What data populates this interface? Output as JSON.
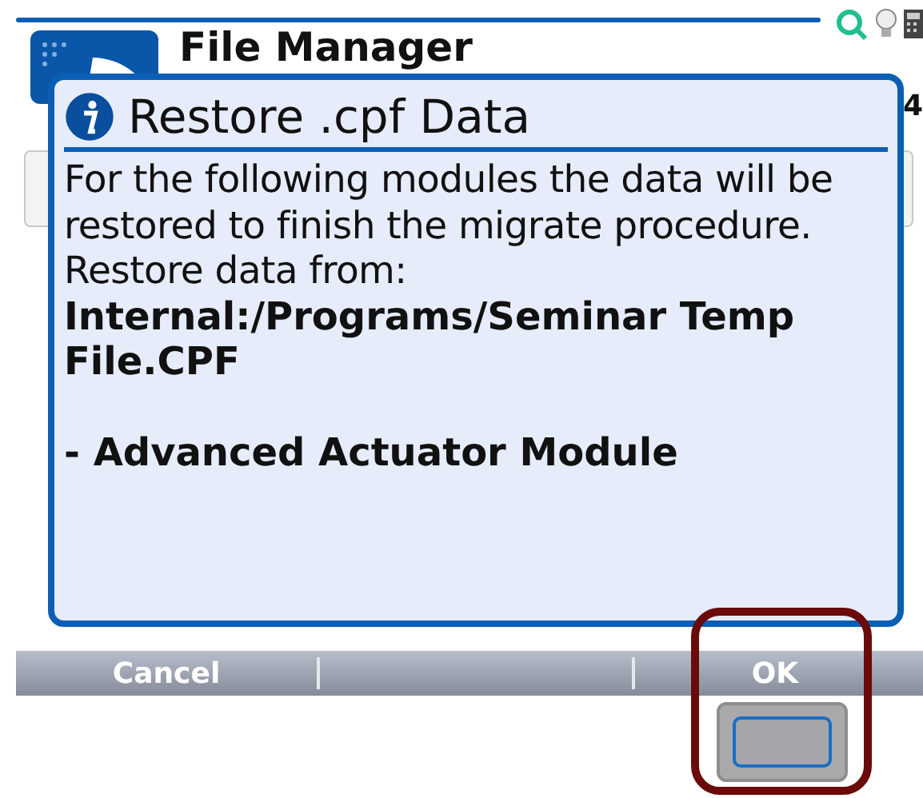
{
  "app": {
    "title": "File Manager",
    "edge_text": "4"
  },
  "dialog": {
    "title": "Restore .cpf Data",
    "lines": [
      {
        "kind": "text",
        "text": "For the following modules the data will be restored to finish the migrate procedure."
      },
      {
        "kind": "text",
        "text": "Restore data from:"
      },
      {
        "kind": "path",
        "text": "Internal:/Programs/Seminar Temp File.CPF"
      },
      {
        "kind": "item",
        "text": "- Advanced Actuator Module"
      }
    ]
  },
  "softkeys": [
    {
      "label": "Cancel"
    },
    {
      "label": "OK"
    }
  ]
}
